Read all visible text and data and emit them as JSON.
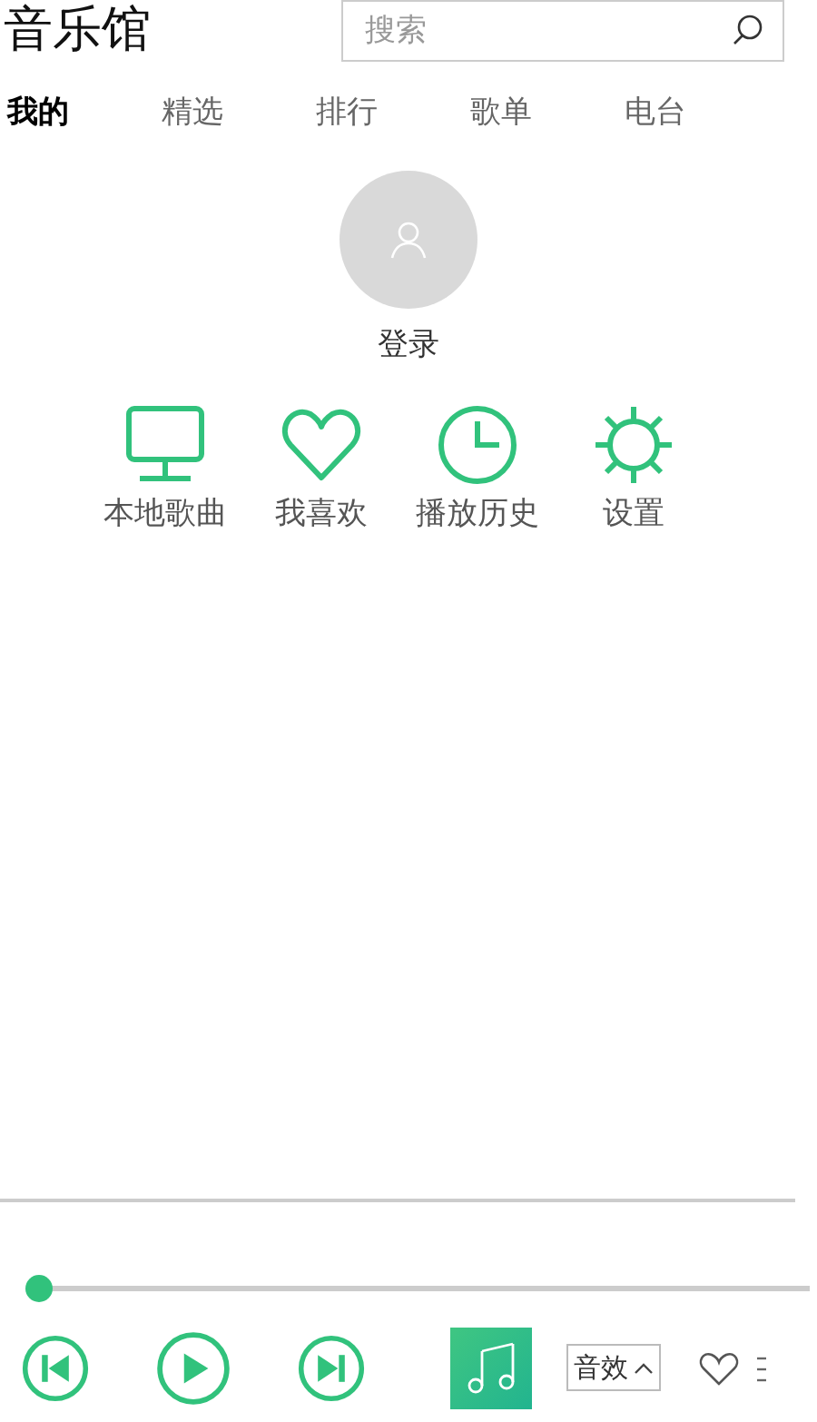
{
  "app_title": "音乐馆",
  "search": {
    "placeholder": "搜索"
  },
  "tabs": [
    {
      "label": "我的",
      "selected": true
    },
    {
      "label": "精选",
      "selected": false
    },
    {
      "label": "排行",
      "selected": false
    },
    {
      "label": "歌单",
      "selected": false
    },
    {
      "label": "电台",
      "selected": false
    }
  ],
  "login": {
    "label": "登录"
  },
  "shortcuts": [
    {
      "kind": "monitor",
      "label": "本地歌曲"
    },
    {
      "kind": "heart",
      "label": "我喜欢"
    },
    {
      "kind": "clock",
      "label": "播放历史"
    },
    {
      "kind": "gear",
      "label": "设置"
    }
  ],
  "player": {
    "progress": {
      "level": 0
    },
    "sound_effects_button": "音效"
  }
}
